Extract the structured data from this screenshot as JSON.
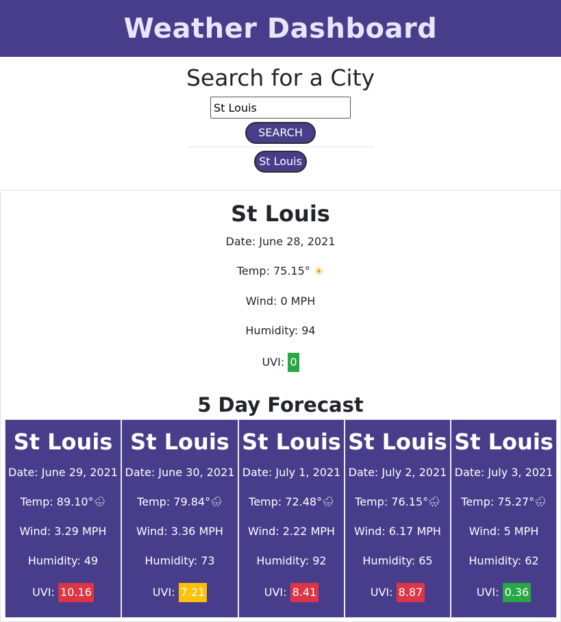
{
  "header": {
    "title": "Weather Dashboard"
  },
  "search": {
    "heading": "Search for a City",
    "input_value": "St Louis",
    "button_label": "SEARCH",
    "history": [
      "St Louis"
    ]
  },
  "current": {
    "city": "St Louis",
    "date": "Date: June 28, 2021",
    "temp": "Temp: 75.15°",
    "icon": "sun-icon",
    "wind": "Wind: 0 MPH",
    "humidity": "Humidity: 94",
    "uvi_label": "UVI:",
    "uvi": "0",
    "uvi_color": "#28a745"
  },
  "forecast": {
    "title": "5 Day Forecast",
    "days": [
      {
        "city": "St Louis",
        "date": "Date: June 29, 2021",
        "temp": "Temp: 89.10°",
        "icon": "rain-cloud-icon",
        "wind": "Wind: 3.29 MPH",
        "humidity": "Humidity: 49",
        "uvi_label": "UVI:",
        "uvi": "10.16",
        "uvi_color": "#dc3545"
      },
      {
        "city": "St Louis",
        "date": "Date: June 30, 2021",
        "temp": "Temp: 79.84°",
        "icon": "rain-cloud-icon",
        "wind": "Wind: 3.36 MPH",
        "humidity": "Humidity: 73",
        "uvi_label": "UVI:",
        "uvi": "7.21",
        "uvi_color": "#ffc107"
      },
      {
        "city": "St Louis",
        "date": "Date: July 1, 2021",
        "temp": "Temp: 72.48°",
        "icon": "rain-cloud-icon",
        "wind": "Wind: 2.22 MPH",
        "humidity": "Humidity: 92",
        "uvi_label": "UVI:",
        "uvi": "8.41",
        "uvi_color": "#dc3545"
      },
      {
        "city": "St Louis",
        "date": "Date: July 2, 2021",
        "temp": "Temp: 76.15°",
        "icon": "rain-cloud-icon",
        "wind": "Wind: 6.17 MPH",
        "humidity": "Humidity: 65",
        "uvi_label": "UVI:",
        "uvi": "8.87",
        "uvi_color": "#dc3545"
      },
      {
        "city": "St Louis",
        "date": "Date: July 3, 2021",
        "temp": "Temp: 75.27°",
        "icon": "rain-cloud-icon",
        "wind": "Wind: 5 MPH",
        "humidity": "Humidity: 62",
        "uvi_label": "UVI:",
        "uvi": "0.36",
        "uvi_color": "#28a745"
      }
    ]
  },
  "colors": {
    "brand": "#483d8b",
    "header_text": "#e6e6fa"
  }
}
